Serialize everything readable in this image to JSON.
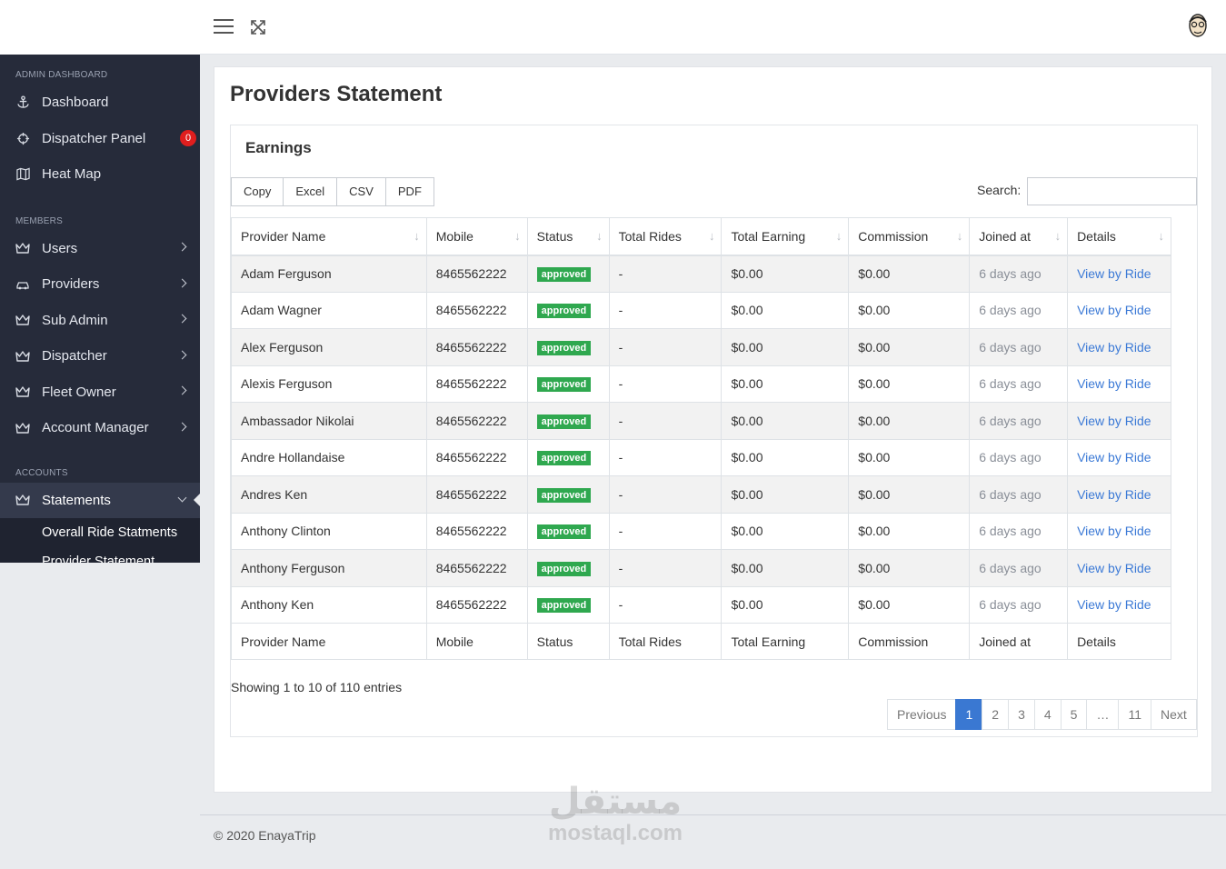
{
  "sidebar": {
    "sections": [
      {
        "header": "ADMIN DASHBOARD",
        "items": [
          {
            "label": "Dashboard",
            "icon": "anchor-icon"
          },
          {
            "label": "Dispatcher Panel",
            "icon": "crosshair-icon",
            "badge": "0"
          },
          {
            "label": "Heat Map",
            "icon": "map-icon"
          }
        ]
      },
      {
        "header": "MEMBERS",
        "items": [
          {
            "label": "Users",
            "icon": "crown-icon"
          },
          {
            "label": "Providers",
            "icon": "car-icon"
          },
          {
            "label": "Sub Admin",
            "icon": "crown-icon"
          },
          {
            "label": "Dispatcher",
            "icon": "crown-icon"
          },
          {
            "label": "Fleet Owner",
            "icon": "crown-icon"
          },
          {
            "label": "Account Manager",
            "icon": "crown-icon"
          }
        ]
      },
      {
        "header": "ACCOUNTS",
        "items": [
          {
            "label": "Statements",
            "icon": "crown-icon"
          }
        ]
      }
    ],
    "subitems": [
      "Overall Ride Statments",
      "Provider Statement"
    ]
  },
  "page": {
    "title": "Providers Statement",
    "card_title": "Earnings",
    "buttons": [
      "Copy",
      "Excel",
      "CSV",
      "PDF"
    ],
    "search_label": "Search:"
  },
  "table": {
    "columns": [
      "Provider Name",
      "Mobile",
      "Status",
      "Total Rides",
      "Total Earning",
      "Commission",
      "Joined at",
      "Details"
    ],
    "rows": [
      {
        "name": "Adam Ferguson",
        "mobile": "8465562222",
        "status": "approved",
        "rides": "-",
        "earning": "$0.00",
        "commission": "$0.00",
        "joined": "6 days ago",
        "details": "View by Ride"
      },
      {
        "name": "Adam Wagner",
        "mobile": "8465562222",
        "status": "approved",
        "rides": "-",
        "earning": "$0.00",
        "commission": "$0.00",
        "joined": "6 days ago",
        "details": "View by Ride"
      },
      {
        "name": "Alex Ferguson",
        "mobile": "8465562222",
        "status": "approved",
        "rides": "-",
        "earning": "$0.00",
        "commission": "$0.00",
        "joined": "6 days ago",
        "details": "View by Ride"
      },
      {
        "name": "Alexis Ferguson",
        "mobile": "8465562222",
        "status": "approved",
        "rides": "-",
        "earning": "$0.00",
        "commission": "$0.00",
        "joined": "6 days ago",
        "details": "View by Ride"
      },
      {
        "name": "Ambassador Nikolai",
        "mobile": "8465562222",
        "status": "approved",
        "rides": "-",
        "earning": "$0.00",
        "commission": "$0.00",
        "joined": "6 days ago",
        "details": "View by Ride"
      },
      {
        "name": "Andre Hollandaise",
        "mobile": "8465562222",
        "status": "approved",
        "rides": "-",
        "earning": "$0.00",
        "commission": "$0.00",
        "joined": "6 days ago",
        "details": "View by Ride"
      },
      {
        "name": "Andres Ken",
        "mobile": "8465562222",
        "status": "approved",
        "rides": "-",
        "earning": "$0.00",
        "commission": "$0.00",
        "joined": "6 days ago",
        "details": "View by Ride"
      },
      {
        "name": "Anthony Clinton",
        "mobile": "8465562222",
        "status": "approved",
        "rides": "-",
        "earning": "$0.00",
        "commission": "$0.00",
        "joined": "6 days ago",
        "details": "View by Ride"
      },
      {
        "name": "Anthony Ferguson",
        "mobile": "8465562222",
        "status": "approved",
        "rides": "-",
        "earning": "$0.00",
        "commission": "$0.00",
        "joined": "6 days ago",
        "details": "View by Ride"
      },
      {
        "name": "Anthony Ken",
        "mobile": "8465562222",
        "status": "approved",
        "rides": "-",
        "earning": "$0.00",
        "commission": "$0.00",
        "joined": "6 days ago",
        "details": "View by Ride"
      }
    ],
    "info": "Showing 1 to 10 of 110 entries"
  },
  "pagination": {
    "items": [
      "Previous",
      "1",
      "2",
      "3",
      "4",
      "5",
      "…",
      "11",
      "Next"
    ],
    "current": "1"
  },
  "footer": "© 2020 EnayaTrip",
  "watermark": {
    "arabic": "مستقل",
    "latin": "mostaql.com"
  },
  "colors": {
    "sidebar": "#262b3a",
    "approved": "#2fa84f",
    "link": "#3c7ad6",
    "pager_active": "#3a78d2",
    "badge": "#e01e1e"
  }
}
